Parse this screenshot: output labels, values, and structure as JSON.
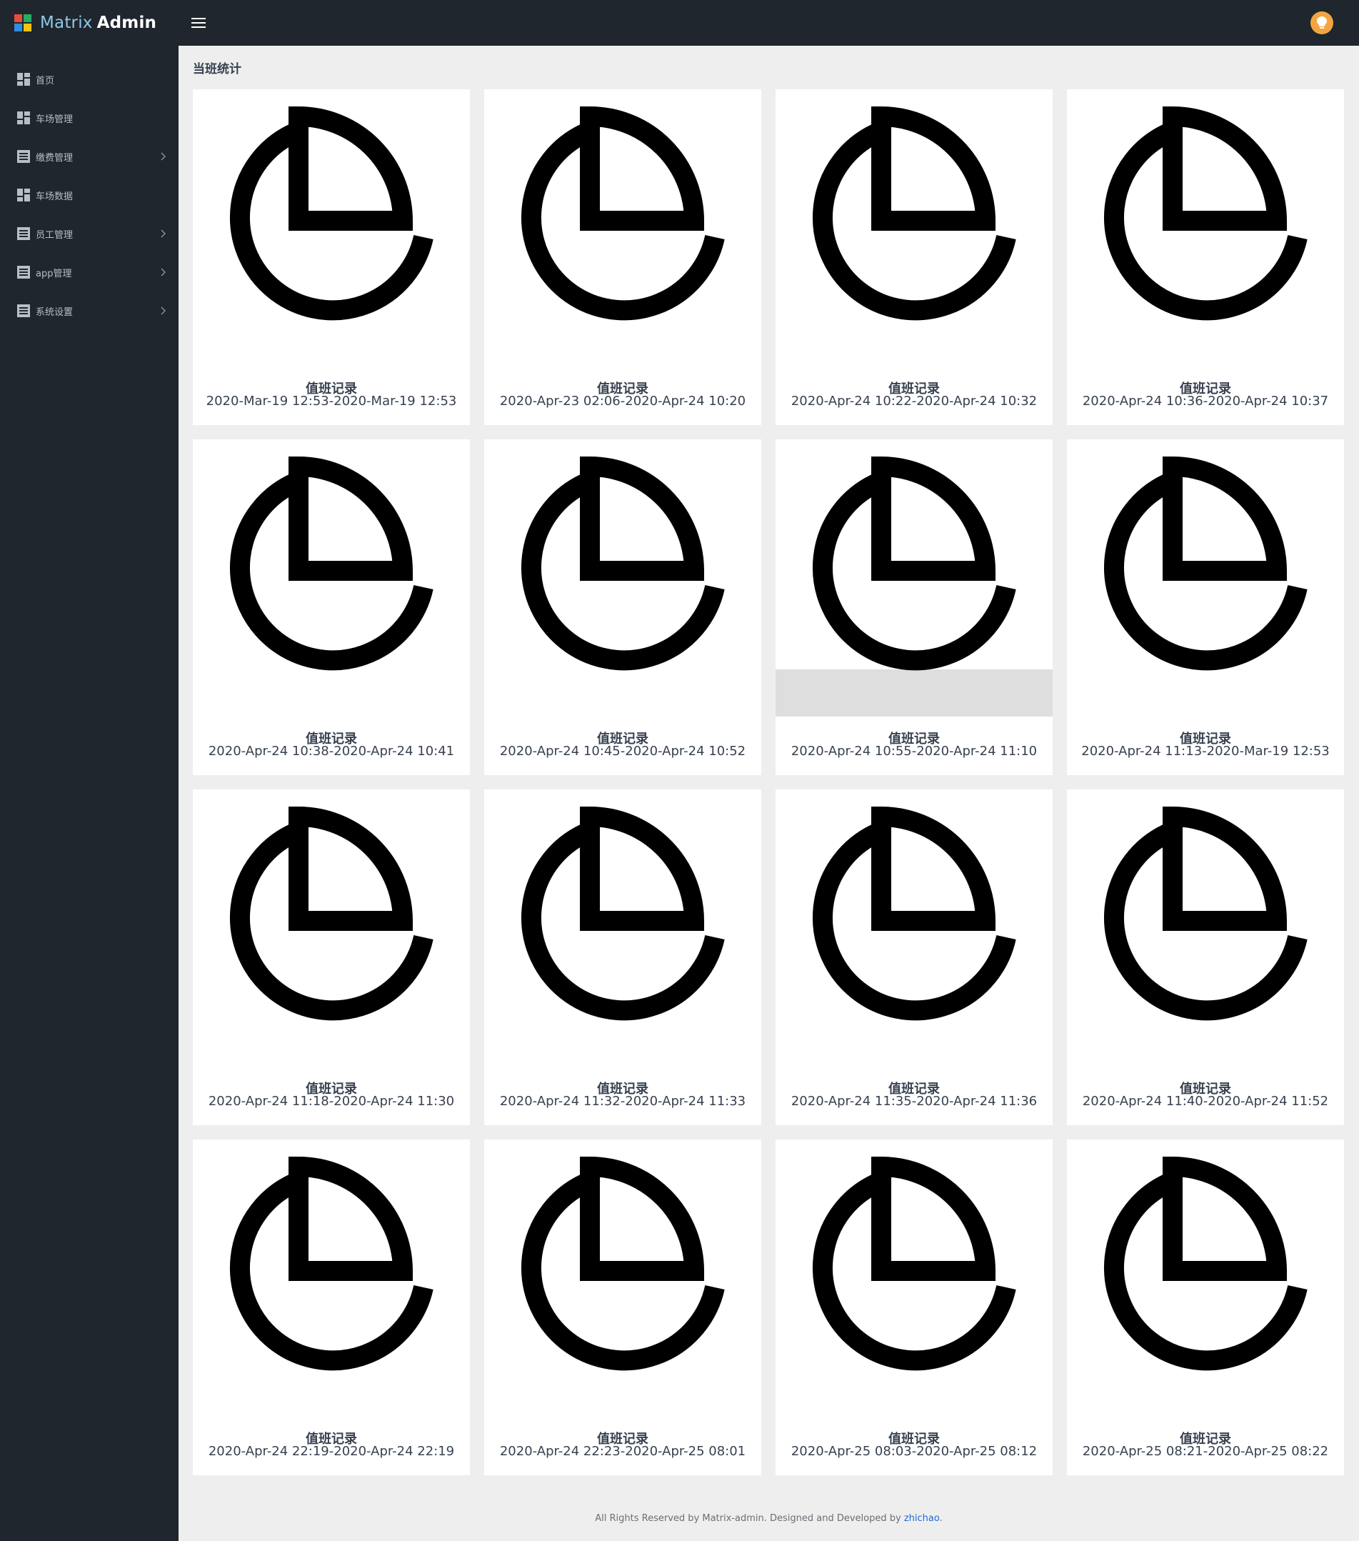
{
  "brand": {
    "light": "Matrix",
    "bold": "Admin"
  },
  "sidebar": {
    "items": [
      {
        "label": "首页",
        "icon": "dashboard-icon",
        "has_chevron": false
      },
      {
        "label": "车场管理",
        "icon": "dashboard-icon",
        "has_chevron": false
      },
      {
        "label": "缴费管理",
        "icon": "list-icon",
        "has_chevron": true
      },
      {
        "label": "车场数据",
        "icon": "dashboard-icon",
        "has_chevron": false
      },
      {
        "label": "员工管理",
        "icon": "list-icon",
        "has_chevron": true
      },
      {
        "label": "app管理",
        "icon": "list-icon",
        "has_chevron": true
      },
      {
        "label": "系统设置",
        "icon": "list-icon",
        "has_chevron": true
      }
    ]
  },
  "page": {
    "title": "当班统计"
  },
  "cards": [
    {
      "title": "值班记录",
      "time": "2020-Mar-19 12:53-2020-Mar-19 12:53"
    },
    {
      "title": "值班记录",
      "time": "2020-Apr-23 02:06-2020-Apr-24 10:20"
    },
    {
      "title": "值班记录",
      "time": "2020-Apr-24 10:22-2020-Apr-24 10:32"
    },
    {
      "title": "值班记录",
      "time": "2020-Apr-24 10:36-2020-Apr-24 10:37"
    },
    {
      "title": "值班记录",
      "time": "2020-Apr-24 10:38-2020-Apr-24 10:41"
    },
    {
      "title": "值班记录",
      "time": "2020-Apr-24 10:45-2020-Apr-24 10:52"
    },
    {
      "title": "值班记录",
      "time": "2020-Apr-24 10:55-2020-Apr-24 11:10",
      "hovered": true
    },
    {
      "title": "值班记录",
      "time": "2020-Apr-24 11:13-2020-Mar-19 12:53"
    },
    {
      "title": "值班记录",
      "time": "2020-Apr-24 11:18-2020-Apr-24 11:30"
    },
    {
      "title": "值班记录",
      "time": "2020-Apr-24 11:32-2020-Apr-24 11:33"
    },
    {
      "title": "值班记录",
      "time": "2020-Apr-24 11:35-2020-Apr-24 11:36"
    },
    {
      "title": "值班记录",
      "time": "2020-Apr-24 11:40-2020-Apr-24 11:52"
    },
    {
      "title": "值班记录",
      "time": "2020-Apr-24 22:19-2020-Apr-24 22:19"
    },
    {
      "title": "值班记录",
      "time": "2020-Apr-24 22:23-2020-Apr-25 08:01"
    },
    {
      "title": "值班记录",
      "time": "2020-Apr-25 08:03-2020-Apr-25 08:12"
    },
    {
      "title": "值班记录",
      "time": "2020-Apr-25 08:21-2020-Apr-25 08:22"
    }
  ],
  "footer": {
    "text": "All Rights Reserved by Matrix-admin. Designed and Developed by ",
    "link": "zhichao",
    "suffix": "."
  },
  "colors": {
    "sidebar_bg": "#1f262d",
    "content_bg": "#eeeeee",
    "accent": "#f3a541",
    "link": "#1f6ad9"
  }
}
